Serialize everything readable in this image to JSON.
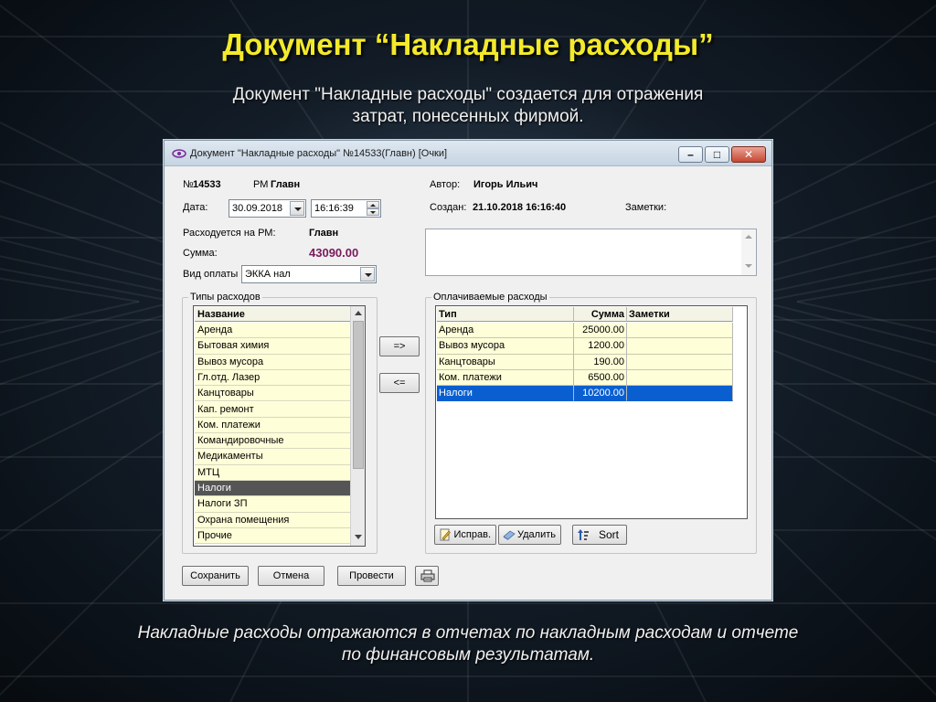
{
  "slide": {
    "title": "Документ “Накладные расходы”",
    "subtitle": "Документ \"Накладные расходы\" создается для отражения затрат, понесенных фирмой.",
    "footer": "Накладные расходы отражаются в отчетах по накладным расходам и отчете по финансовым результатам."
  },
  "window": {
    "title": "Документ \"Накладные расходы\" №14533(Главн) [Очки]",
    "min_glyph": "–",
    "max_glyph": "□",
    "close_glyph": "✕"
  },
  "doc": {
    "number_prefix": "№",
    "number": "14533",
    "rm_label": "РМ",
    "rm_value": "Главн",
    "author_label": "Автор:",
    "author_value": "Игорь Ильич",
    "date_label": "Дата:",
    "date_value": "30.09.2018",
    "time_value": "16:16:39",
    "created_label": "Создан:",
    "created_value": "21.10.2018 16:16:40",
    "notes_label": "Заметки:",
    "spent_on_label": "Расходуется на РМ:",
    "spent_on_value": "Главн",
    "sum_label": "Сумма:",
    "sum_value": "43090.00",
    "payment_label": "Вид оплаты",
    "payment_value": "ЭККА нал"
  },
  "types_group": {
    "caption": "Типы расходов",
    "header": "Название",
    "items": [
      {
        "label": "Аренда"
      },
      {
        "label": "Бытовая химия"
      },
      {
        "label": "Вывоз мусора"
      },
      {
        "label": "Гл.отд. Лазер"
      },
      {
        "label": "Канцтовары"
      },
      {
        "label": "Кап. ремонт"
      },
      {
        "label": "Ком. платежи"
      },
      {
        "label": "Командировочные"
      },
      {
        "label": "Медикаменты"
      },
      {
        "label": "МТЦ"
      },
      {
        "label": "Налоги"
      },
      {
        "label": "Налоги ЗП"
      },
      {
        "label": "Охрана помещения"
      },
      {
        "label": "Прочие"
      }
    ],
    "selected_index": 10
  },
  "move_buttons": {
    "add": "=>",
    "remove": "<="
  },
  "paid_group": {
    "caption": "Оплачиваемые расходы",
    "columns": [
      "Тип",
      "Сумма",
      "Заметки"
    ],
    "rows": [
      {
        "type": "Аренда",
        "sum": "25000.00",
        "note": ""
      },
      {
        "type": "Вывоз мусора",
        "sum": "1200.00",
        "note": ""
      },
      {
        "type": "Канцтовары",
        "sum": "190.00",
        "note": ""
      },
      {
        "type": "Ком. платежи",
        "sum": "6500.00",
        "note": ""
      },
      {
        "type": "Налоги",
        "sum": "10200.00",
        "note": ""
      }
    ],
    "selected_index": 4,
    "edit_button": "Исправ.",
    "delete_button": "Удалить",
    "sort_button": "Sort"
  },
  "footer_buttons": {
    "save": "Сохранить",
    "cancel": "Отмена",
    "post": "Провести"
  },
  "colors": {
    "title_yellow": "#f3ea2a",
    "sum_purple": "#7a1a5a",
    "grid_selection": "#0a5fd0",
    "list_selection": "#555555",
    "row_yellow": "#fefed8"
  }
}
